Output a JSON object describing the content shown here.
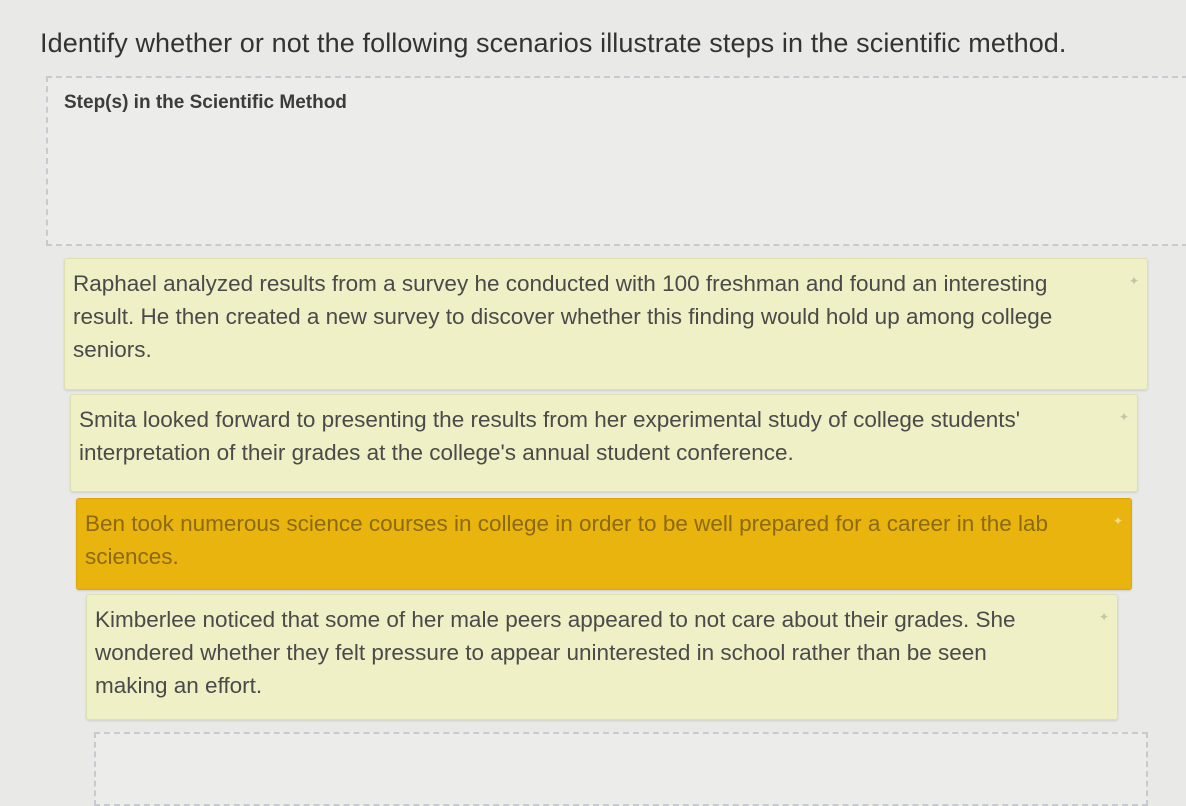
{
  "question": "Identify whether or not the following scenarios illustrate steps in the scientific method.",
  "dropzone": {
    "title": "Step(s) in the Scientific Method"
  },
  "cards": [
    {
      "text": "Raphael analyzed results from a survey he conducted with 100 freshman and found an interesting result. He then created a new survey to discover whether this finding would hold up among college seniors.",
      "selected": false
    },
    {
      "text": "Smita looked forward to presenting the results from her experimental study of college students' interpretation of their grades at the college's annual student conference.",
      "selected": false
    },
    {
      "text": "Ben took numerous science courses in college in order to be well prepared for a career in the lab sciences.",
      "selected": true
    },
    {
      "text": "Kimberlee noticed that some of her male peers appeared to not care about their grades. She wondered whether they felt pressure to appear uninterested in school rather than be seen making an effort.",
      "selected": false
    }
  ],
  "icons": {
    "card_corner": "star-icon"
  },
  "colors": {
    "card_background": "#eff0c5",
    "selected_card_background": "#e8b40d"
  }
}
